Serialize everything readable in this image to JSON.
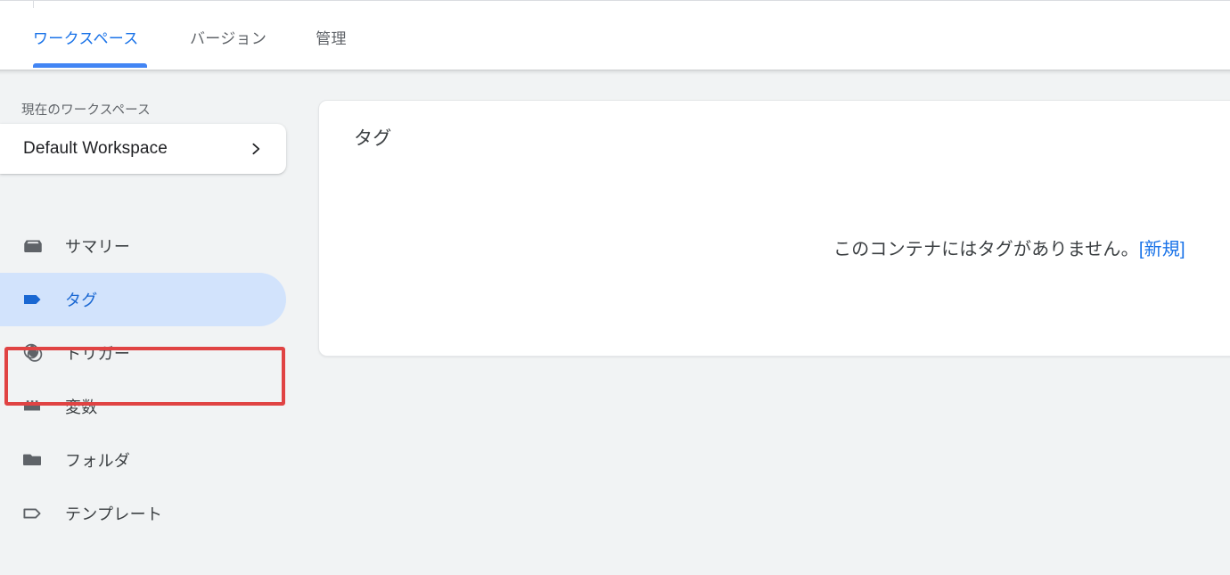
{
  "header": {
    "tabs": [
      {
        "label": "ワークスペース",
        "active": true,
        "name": "tab-workspace"
      },
      {
        "label": "バージョン",
        "active": false,
        "name": "tab-version"
      },
      {
        "label": "管理",
        "active": false,
        "name": "tab-admin"
      }
    ]
  },
  "sidebar": {
    "workspace_caption": "現在のワークスペース",
    "workspace_name": "Default Workspace",
    "workspace_chevron_icon": "chevron-right-icon",
    "items": [
      {
        "label": "サマリー",
        "icon": "summary-box-icon",
        "selected": false
      },
      {
        "label": "タグ",
        "icon": "tag-filled-icon",
        "selected": true
      },
      {
        "label": "トリガー",
        "icon": "trigger-circle-icon",
        "selected": false
      },
      {
        "label": "変数",
        "icon": "variable-brick-icon",
        "selected": false
      },
      {
        "label": "フォルダ",
        "icon": "folder-icon",
        "selected": false
      },
      {
        "label": "テンプレート",
        "icon": "tag-outline-icon",
        "selected": false
      }
    ]
  },
  "main": {
    "card_title": "タグ",
    "empty_message_text": "このコンテナにはタグがありません。",
    "empty_message_link": "[新規]"
  },
  "colors": {
    "accent_blue": "#1a73e8",
    "tab_underline": "#4285f4",
    "selected_bg": "#d2e3fc",
    "selected_text": "#1967d2",
    "page_bg": "#f1f3f4",
    "annotation_red": "#e04343",
    "icon_gray": "#5f6368"
  }
}
